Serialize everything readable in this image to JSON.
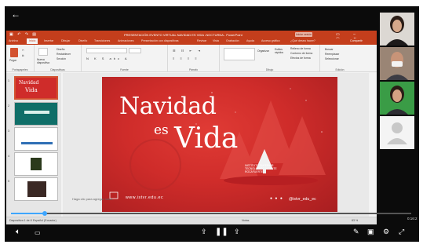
{
  "player": {
    "back_icon": "arrow-left-icon",
    "time_current": "0:44",
    "time_end": "0:16:2",
    "progress": 0.085
  },
  "pp": {
    "window_title": "PRESENTACIÓN EVENTO VIRTUAL NAVIDAD ES VIDA -NOCTURNA - PowerPoint",
    "signin_label": "Iniciar sesión",
    "tabs": [
      "Archivo",
      "Inicio",
      "Insertar",
      "Dibujar",
      "Diseño",
      "Transiciones",
      "Animaciones",
      "Presentación con diapositivas",
      "Revisar",
      "Vista",
      "Grabación",
      "Ayuda",
      "Acceso gráfico",
      "¿Qué desea hacer?"
    ],
    "share_label": "Compartir",
    "ribbon": {
      "groups": [
        "Portapapeles",
        "Diapositivas",
        "Fuente",
        "Párrafo",
        "Dibujo",
        "Edición"
      ],
      "paste": "Pegar",
      "new_slide": "Nueva diapositiva",
      "design": "Diseño",
      "reset": "Restablecer",
      "section": "Sección",
      "arrange": "Organizar",
      "quick_styles": "Estilos rápidos",
      "fill": "Relleno de forma",
      "outline": "Contorno de forma",
      "effects": "Efectos de forma",
      "find": "Buscar",
      "replace": "Reemplazar",
      "select": "Seleccionar"
    },
    "thumbs": [
      "1",
      "2",
      "3",
      "4",
      "5"
    ],
    "slide": {
      "title_line1": "Navidad",
      "title_line2a": "es",
      "title_line2b": "Vida",
      "url": "www.istvr.edu.ec",
      "handle": "@istvr_edu_ec",
      "logo_text": "INSTITUTO SUPERIOR TECNOLÓGICO VICENTE ROCAFUERTE"
    },
    "notes_placeholder": "Haga clic para agregar notas",
    "status": {
      "slide_info": "Diapositiva 1 de 8",
      "language": "Español (Ecuador)",
      "notes_btn": "Notas",
      "comments_btn": "Comentarios",
      "zoom": "83 %"
    }
  },
  "participants": [
    "participant-1",
    "participant-2",
    "participant-3",
    "participant-4"
  ],
  "controls": {
    "left": [
      "volume-icon",
      "slides-icon"
    ],
    "center": [
      "emoji-icon",
      "pause-icon",
      "share-icon"
    ],
    "right": [
      "pen-icon",
      "screen-icon",
      "settings-icon",
      "fullscreen-icon"
    ]
  },
  "colors": {
    "accent": "#c43e1c",
    "slide_red": "#cf2c2a",
    "progress": "#3ea6ff"
  }
}
